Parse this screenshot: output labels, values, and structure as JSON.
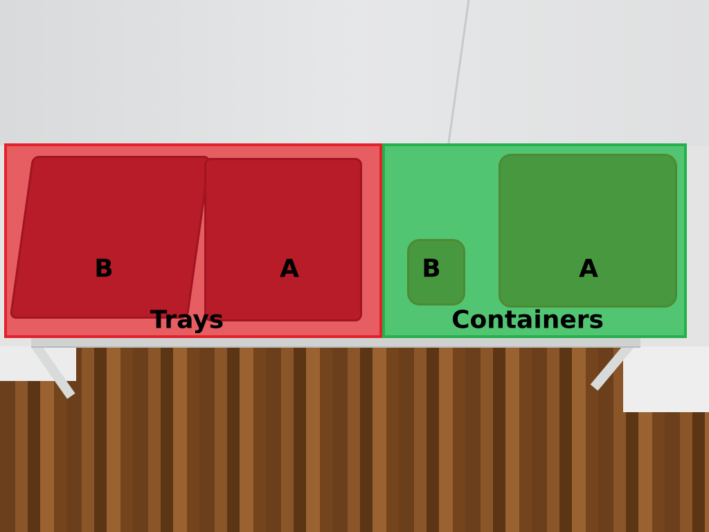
{
  "regions": [
    {
      "label": "Trays",
      "color": "#e8282f",
      "items": [
        {
          "label": "B"
        },
        {
          "label": "A"
        }
      ]
    },
    {
      "label": "Containers",
      "color": "#2ab34c",
      "items": [
        {
          "label": "B"
        },
        {
          "label": "A"
        }
      ]
    }
  ]
}
